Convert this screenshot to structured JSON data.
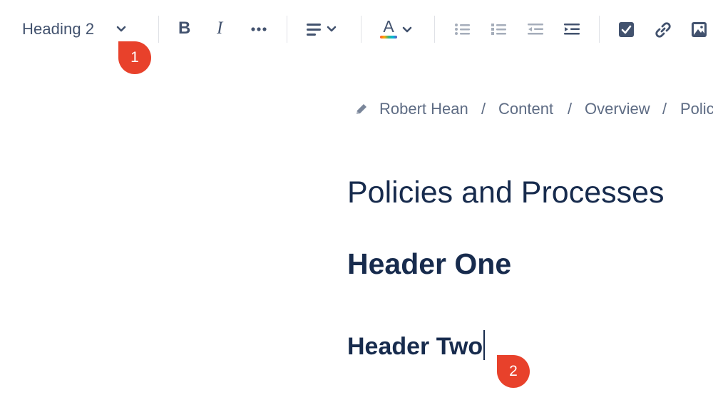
{
  "toolbar": {
    "text_style": "Heading 2",
    "icons": [
      "chevron-down-icon",
      "bold-icon",
      "italic-icon",
      "more-formatting-icon",
      "align-icon",
      "text-color-icon",
      "bullet-list-icon",
      "numbered-list-icon",
      "outdent-icon",
      "indent-icon",
      "task-checkbox-icon",
      "link-icon",
      "image-icon"
    ],
    "bold_label": "B",
    "italic_label": "I",
    "text_color_label": "A"
  },
  "callouts": {
    "first": "1",
    "second": "2"
  },
  "breadcrumb": {
    "items": [
      "Robert Hean",
      "Content",
      "Overview",
      "Polic"
    ],
    "separator": "/"
  },
  "content": {
    "title": "Policies and Processes",
    "heading_one": "Header One",
    "heading_two": "Header Two"
  },
  "colors": {
    "callout": "#e8412b",
    "text": "#172b4d",
    "toolbar_icon": "#42526e",
    "muted": "#5e6c84"
  }
}
